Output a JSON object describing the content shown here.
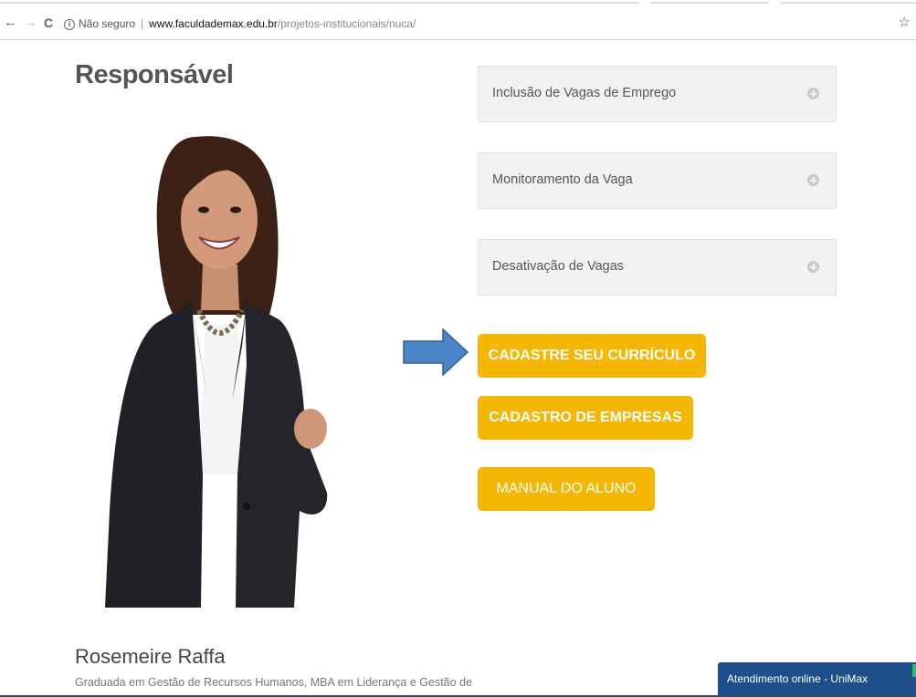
{
  "browser": {
    "back_glyph": "←",
    "forward_glyph": "→",
    "reload_glyph": "C",
    "info_glyph": "i",
    "security_text": "Não seguro",
    "separator": "|",
    "url_host": "www.faculdademax.edu.br",
    "url_path": "/projetos-institucionais/nuca/",
    "star_glyph": "☆"
  },
  "page": {
    "title": "Responsável"
  },
  "accordion": [
    {
      "label": "Inclusão de Vagas de Emprego"
    },
    {
      "label": "Monitoramento da Vaga"
    },
    {
      "label": "Desativação de Vagas"
    }
  ],
  "buttons": {
    "cadastre": "CADASTRE SEU CURRÍCULO",
    "empresas": "CADASTRO DE EMPRESAS",
    "manual": "MANUAL DO ALUNO"
  },
  "person": {
    "name": "Rosemeire Raffa",
    "description": "Graduada em Gestão de Recursos Humanos, MBA em Liderança e Gestão de"
  },
  "chat": {
    "label": "Atendimento online - UniMax"
  },
  "colors": {
    "button": "#f5b703",
    "arrow": "#4a86c8",
    "chat": "#1f4f8b"
  }
}
